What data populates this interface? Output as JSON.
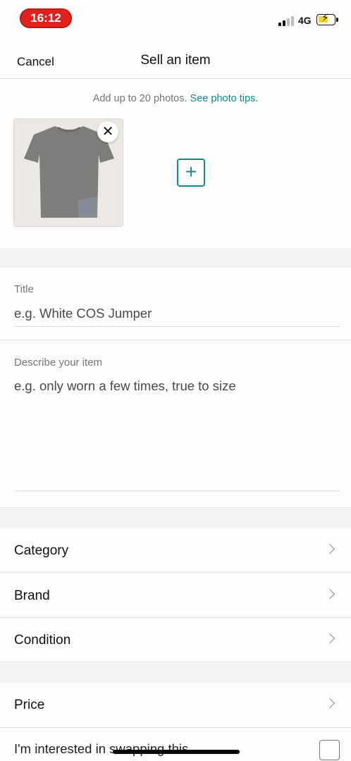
{
  "status_bar": {
    "time": "16:12",
    "network": "4G"
  },
  "nav": {
    "cancel_label": "Cancel",
    "title": "Sell an item"
  },
  "photos": {
    "hint_text": "Add up to 20 photos.",
    "hint_link": "See photo tips.",
    "remove_symbol": "✕",
    "add_symbol": "+"
  },
  "title_field": {
    "label": "Title",
    "placeholder": "e.g. White COS Jumper"
  },
  "description_field": {
    "label": "Describe your item",
    "placeholder": "e.g. only worn a few times, true to size"
  },
  "rows": [
    {
      "label": "Category"
    },
    {
      "label": "Brand"
    },
    {
      "label": "Condition"
    },
    {
      "label": "Price"
    }
  ],
  "swap": {
    "label": "I'm interested in swapping this"
  },
  "colors": {
    "accent": "#138a8a",
    "time_pill": "#e0211d",
    "battery": "#f3d22b"
  },
  "icons": [
    "signal-icon",
    "battery-icon",
    "close-icon",
    "plus-icon",
    "chevron-right-icon",
    "checkbox-icon"
  ]
}
